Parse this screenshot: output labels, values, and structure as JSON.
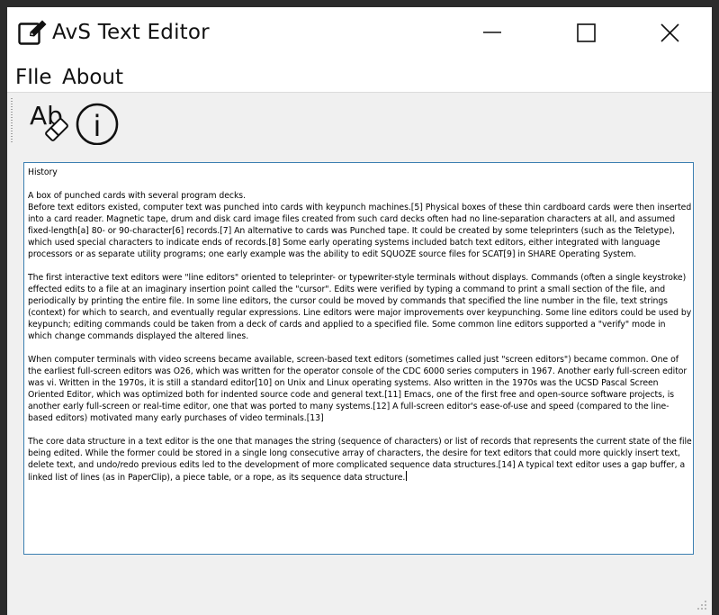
{
  "window": {
    "title": "AvS Text Editor",
    "app_icon": "edit-icon",
    "controls": {
      "minimize_icon": "minimize-icon",
      "maximize_icon": "maximize-icon",
      "close_icon": "close-icon"
    }
  },
  "menubar": {
    "items": [
      {
        "label": "FIle"
      },
      {
        "label": "About"
      }
    ]
  },
  "toolbar": {
    "buttons": [
      {
        "icon": "spell-check-eraser-icon",
        "glyph": "Ab"
      },
      {
        "icon": "info-icon",
        "glyph": "i"
      }
    ]
  },
  "editor": {
    "text": "History\n\nA box of punched cards with several program decks.\nBefore text editors existed, computer text was punched into cards with keypunch machines.[5] Physical boxes of these thin cardboard cards were then inserted into a card reader. Magnetic tape, drum and disk card image files created from such card decks often had no line-separation characters at all, and assumed fixed-length[a] 80- or 90-character[6] records.[7] An alternative to cards was Punched tape. It could be created by some teleprinters (such as the Teletype), which used special characters to indicate ends of records.[8] Some early operating systems included batch text editors, either integrated with language processors or as separate utility programs; one early example was the ability to edit SQUOZE source files for SCAT[9] in SHARE Operating System.\n\nThe first interactive text editors were \"line editors\" oriented to teleprinter- or typewriter-style terminals without displays. Commands (often a single keystroke) effected edits to a file at an imaginary insertion point called the \"cursor\". Edits were verified by typing a command to print a small section of the file, and periodically by printing the entire file. In some line editors, the cursor could be moved by commands that specified the line number in the file, text strings (context) for which to search, and eventually regular expressions. Line editors were major improvements over keypunching. Some line editors could be used by keypunch; editing commands could be taken from a deck of cards and applied to a specified file. Some common line editors supported a \"verify\" mode in which change commands displayed the altered lines.\n\nWhen computer terminals with video screens became available, screen-based text editors (sometimes called just \"screen editors\") became common. One of the earliest full-screen editors was O26, which was written for the operator console of the CDC 6000 series computers in 1967. Another early full-screen editor was vi. Written in the 1970s, it is still a standard editor[10] on Unix and Linux operating systems. Also written in the 1970s was the UCSD Pascal Screen Oriented Editor, which was optimized both for indented source code and general text.[11] Emacs, one of the first free and open-source software projects, is another early full-screen or real-time editor, one that was ported to many systems.[12] A full-screen editor's ease-of-use and speed (compared to the line-based editors) motivated many early purchases of video terminals.[13]\n\nThe core data structure in a text editor is the one that manages the string (sequence of characters) or list of records that represents the current state of the file being edited. While the former could be stored in a single long consecutive array of characters, the desire for text editors that could more quickly insert text, delete text, and undo/redo previous edits led to the development of more complicated sequence data structures.[14] A typical text editor uses a gap buffer, a linked list of lines (as in PaperClip), a piece table, or a rope, as its sequence data structure."
  },
  "colors": {
    "editor_border": "#3c7fb1",
    "window_background": "#f0f0f0",
    "titlebar_background": "#ffffff"
  }
}
